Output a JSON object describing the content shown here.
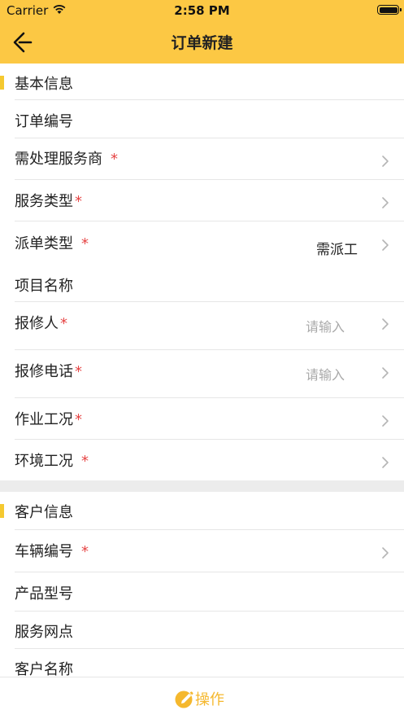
{
  "status_bar": {
    "carrier": "Carrier",
    "time": "2:58 PM"
  },
  "nav": {
    "title": "订单新建",
    "back_icon": "back-arrow-icon"
  },
  "colors": {
    "brand": "#FCC844",
    "accent": "#F5C930",
    "required": "#E64545",
    "operate": "#F5B82E",
    "placeholder": "#a9a9a9"
  },
  "sections": {
    "basic": {
      "title": "基本信息",
      "rows": [
        {
          "label": "订单编号",
          "required": false,
          "value": "",
          "placeholder": "",
          "chevron": false
        },
        {
          "label": "需处理服务商",
          "required": true,
          "value": "",
          "placeholder": "",
          "chevron": true
        },
        {
          "label": "服务类型",
          "required": true,
          "value": "",
          "placeholder": "",
          "chevron": true
        },
        {
          "label": "派单类型",
          "required": true,
          "value": "需派工",
          "placeholder": "",
          "chevron": true
        },
        {
          "label": "项目名称",
          "required": false,
          "value": "",
          "placeholder": "",
          "chevron": false
        },
        {
          "label": "报修人",
          "required": true,
          "value": "",
          "placeholder": "请输入",
          "chevron": true
        },
        {
          "label": "报修电话",
          "required": true,
          "value": "",
          "placeholder": "请输入",
          "chevron": true
        },
        {
          "label": "作业工况",
          "required": true,
          "value": "",
          "placeholder": "",
          "chevron": true
        },
        {
          "label": "环境工况",
          "required": true,
          "value": "",
          "placeholder": "",
          "chevron": true
        }
      ]
    },
    "customer": {
      "title": "客户信息",
      "rows": [
        {
          "label": "车辆编号",
          "required": true,
          "value": "",
          "placeholder": "",
          "chevron": true
        },
        {
          "label": "产品型号",
          "required": false,
          "value": "",
          "placeholder": "",
          "chevron": false
        },
        {
          "label": "服务网点",
          "required": false,
          "value": "",
          "placeholder": "",
          "chevron": false
        },
        {
          "label": "客户名称",
          "required": false,
          "value": "",
          "placeholder": "",
          "chevron": false
        }
      ]
    }
  },
  "required_mark": "*",
  "bottom": {
    "operate_label": "操作",
    "operate_icon": "pencil-circle-icon"
  }
}
